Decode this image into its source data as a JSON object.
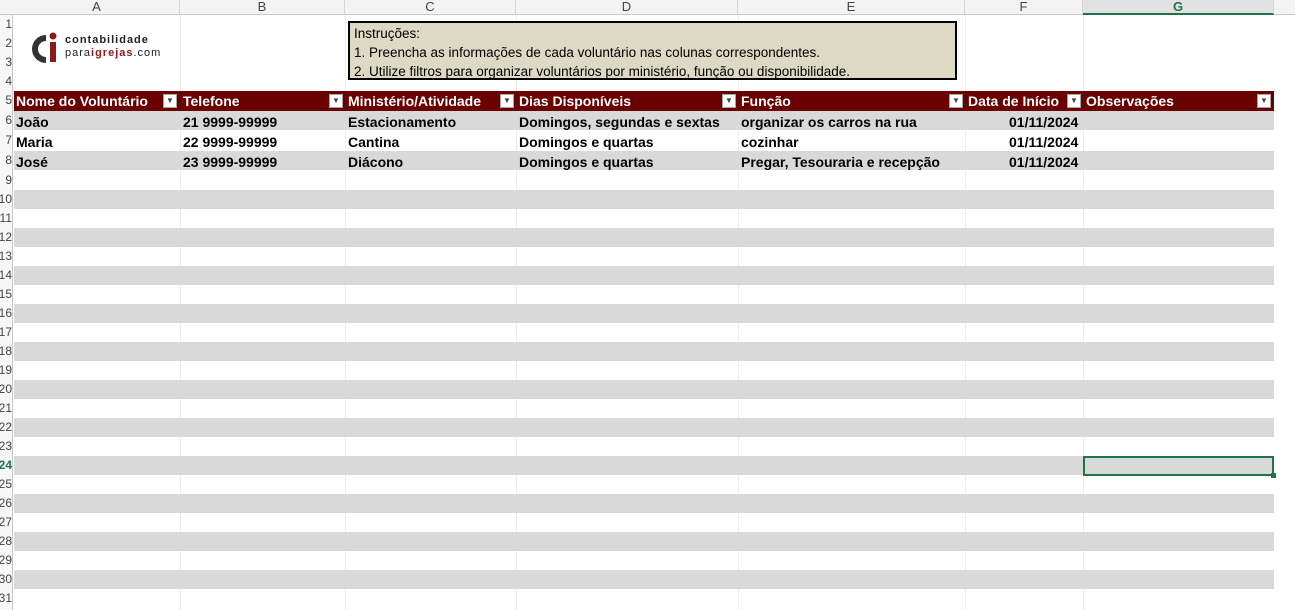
{
  "columns": [
    "A",
    "B",
    "C",
    "D",
    "E",
    "F",
    "G"
  ],
  "selected_column": "G",
  "rows": [
    "1",
    "2",
    "3",
    "4",
    "5",
    "6",
    "7",
    "8",
    "9",
    "10",
    "11",
    "12",
    "13",
    "14",
    "15",
    "16",
    "17",
    "18",
    "19",
    "20",
    "21",
    "22",
    "23",
    "24",
    "25",
    "26",
    "27",
    "28",
    "29",
    "30",
    "31"
  ],
  "selected_row": "24",
  "logo": {
    "line1": "contabilidade",
    "line2_a": "para",
    "line2_b": "igrejas",
    "line2_c": ".com",
    "mark": "ci"
  },
  "instructions": {
    "title": "Instruções:",
    "line1": "1. Preencha as informações de cada voluntário nas colunas correspondentes.",
    "line2": "2. Utilize filtros para organizar voluntários por ministério, função ou disponibilidade."
  },
  "table": {
    "headers": [
      "Nome do Voluntário",
      "Telefone",
      "Ministério/Atividade",
      "Dias Disponíveis",
      "Função",
      "Data de Início",
      "Observações"
    ],
    "rows": [
      [
        "João",
        "21 9999-99999",
        "Estacionamento",
        "Domingos, segundas e sextas",
        "organizar os carros na rua",
        "01/11/2024",
        ""
      ],
      [
        "Maria",
        "22 9999-99999",
        "Cantina",
        "Domingos e quartas",
        "cozinhar",
        "01/11/2024",
        ""
      ],
      [
        "José",
        "23 9999-99999",
        "Diácono",
        "Domingos e quartas",
        "Pregar, Tesouraria e recepção",
        "01/11/2024",
        ""
      ]
    ]
  },
  "colors": {
    "header_bg": "#6b0000",
    "band_bg": "#d9d9d9",
    "instr_bg": "#ddd9c4",
    "select": "#217346"
  }
}
